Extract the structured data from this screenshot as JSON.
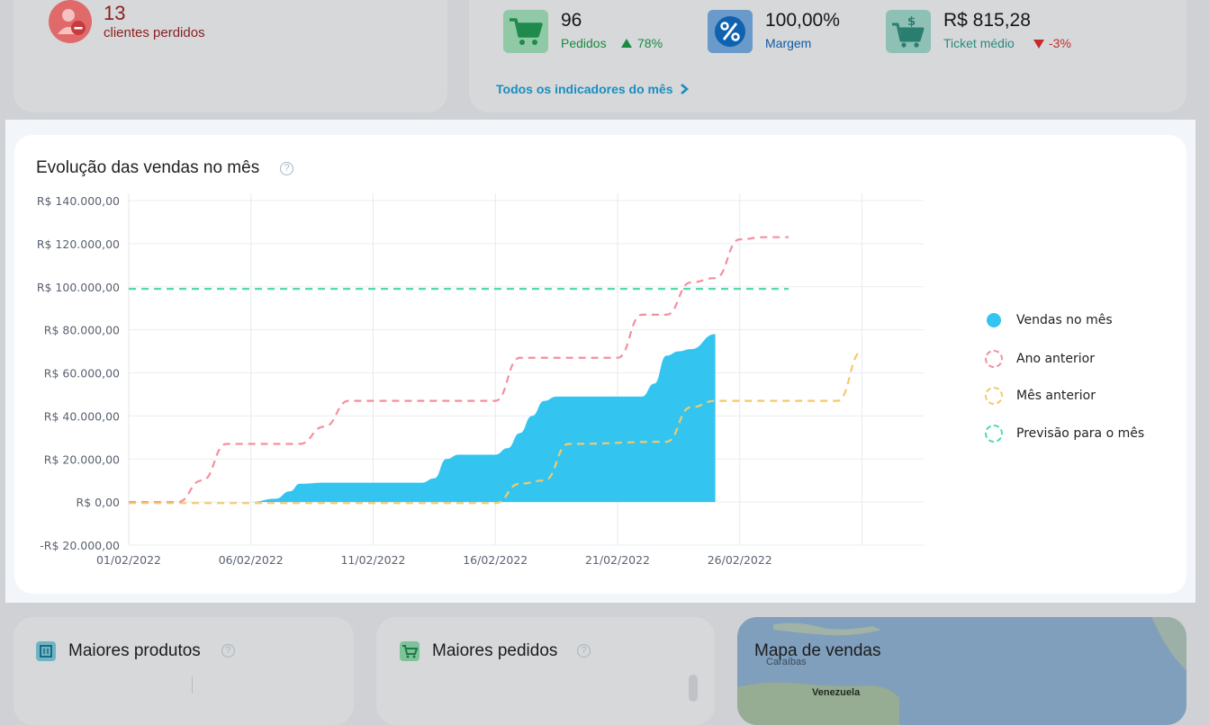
{
  "top_left": {
    "value": "13",
    "label": "clientes perdidos"
  },
  "kpis": {
    "pedidos": {
      "value": "96",
      "label": "Pedidos",
      "change": "78%",
      "change_dir": "up"
    },
    "margem": {
      "value": "100,00%",
      "label": "Margem"
    },
    "ticket": {
      "value": "R$ 815,28",
      "label": "Ticket médio",
      "change": "-3%",
      "change_dir": "down"
    },
    "all_link": "Todos os indicadores do mês"
  },
  "chart": {
    "title": "Evolução das vendas no mês",
    "legend": [
      {
        "name": "Vendas no mês",
        "color": "#33c5f0"
      },
      {
        "name": "Ano anterior",
        "color": "#f58f9f"
      },
      {
        "name": "Mês anterior",
        "color": "#f5c96a"
      },
      {
        "name": "Previsão para o mês",
        "color": "#54d9a8"
      }
    ]
  },
  "chart_data": {
    "type": "area",
    "x_ticks": [
      "01/02/2022",
      "06/02/2022",
      "11/02/2022",
      "16/02/2022",
      "21/02/2022",
      "26/02/2022"
    ],
    "y_ticks": [
      "-R$ 20.000,00",
      "R$ 0,00",
      "R$ 20.000,00",
      "R$ 40.000,00",
      "R$ 60.000,00",
      "R$ 80.000,00",
      "R$ 100.000,00",
      "R$ 120.000,00",
      "R$ 140.000,00"
    ],
    "ylim": [
      -20000,
      140000
    ],
    "x_day_range": [
      1,
      31
    ],
    "grid": true,
    "legend_position": "right",
    "series": [
      {
        "name": "Vendas no mês",
        "style": "area",
        "color": "#33c5f0",
        "points": [
          [
            1,
            0
          ],
          [
            5,
            0
          ],
          [
            6,
            0
          ],
          [
            7,
            1500
          ],
          [
            7.6,
            5000
          ],
          [
            8,
            8500
          ],
          [
            9,
            9000
          ],
          [
            13,
            9000
          ],
          [
            13.5,
            11000
          ],
          [
            14,
            20000
          ],
          [
            14.5,
            22000
          ],
          [
            16,
            22000
          ],
          [
            16.5,
            25000
          ],
          [
            17,
            32000
          ],
          [
            17.5,
            40000
          ],
          [
            18,
            47000
          ],
          [
            18.5,
            49000
          ],
          [
            22,
            49000
          ],
          [
            22.5,
            55000
          ],
          [
            23,
            68000
          ],
          [
            23.5,
            70000
          ],
          [
            24,
            71000
          ],
          [
            25,
            78000
          ]
        ]
      },
      {
        "name": "Ano anterior",
        "style": "dashed",
        "color": "#f58f9f",
        "points": [
          [
            1,
            0
          ],
          [
            3,
            0
          ],
          [
            4,
            10000
          ],
          [
            5,
            27000
          ],
          [
            8,
            27000
          ],
          [
            9,
            35000
          ],
          [
            10,
            47000
          ],
          [
            16,
            47000
          ],
          [
            17,
            67000
          ],
          [
            21,
            67000
          ],
          [
            22,
            87000
          ],
          [
            23,
            87000
          ],
          [
            24,
            102000
          ],
          [
            25,
            104000
          ],
          [
            26,
            122000
          ],
          [
            27,
            123000
          ],
          [
            28,
            123000
          ]
        ]
      },
      {
        "name": "Mês anterior",
        "style": "dashed",
        "color": "#f5c96a",
        "points": [
          [
            1,
            -500
          ],
          [
            16,
            -500
          ],
          [
            17,
            8500
          ],
          [
            18,
            10000
          ],
          [
            19,
            27000
          ],
          [
            23,
            28000
          ],
          [
            24,
            44000
          ],
          [
            25,
            47000
          ],
          [
            30,
            47000
          ],
          [
            31,
            70000
          ]
        ]
      },
      {
        "name": "Previsão para o mês",
        "style": "dashed",
        "color": "#54d9a8",
        "points": [
          [
            1,
            99000
          ],
          [
            28,
            99000
          ]
        ]
      }
    ]
  },
  "bottom": {
    "produtos": "Maiores produtos",
    "pedidos": "Maiores pedidos",
    "mapa": "Mapa de vendas",
    "map_label_1": "Caraíbas",
    "map_label_2": "Venezuela"
  }
}
